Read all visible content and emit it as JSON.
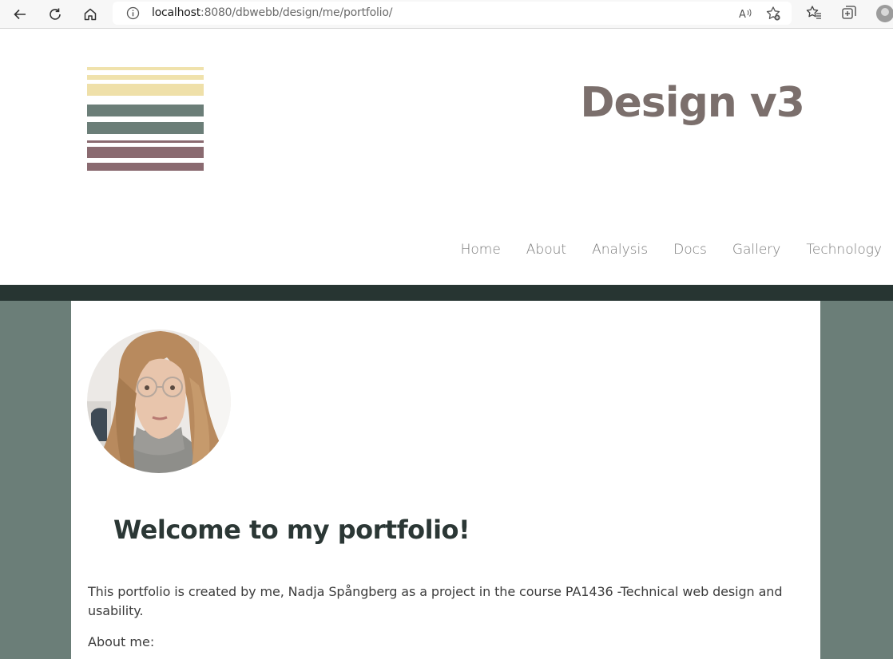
{
  "browser": {
    "url_host": "localhost",
    "url_rest": ":8080/dbwebb/design/me/portfolio/",
    "icons": [
      "back-icon",
      "refresh-icon",
      "home-icon",
      "info-icon",
      "read-aloud-icon",
      "add-favorite-icon",
      "favorites-icon",
      "collections-icon",
      "profile-icon"
    ]
  },
  "site": {
    "title": "Design v3",
    "logo_colors": [
      "#f3e5b0",
      "#6b7e78",
      "#8a6a70"
    ],
    "nav": [
      {
        "label": "Home"
      },
      {
        "label": "About"
      },
      {
        "label": "Analysis"
      },
      {
        "label": "Docs"
      },
      {
        "label": "Gallery"
      },
      {
        "label": "Technology"
      }
    ]
  },
  "main": {
    "heading": "Welcome to my portfolio!",
    "intro": "This portfolio is created by me, Nadja Spångberg as a project in the course PA1436 -Technical web design and usability.",
    "about_label": "About me:"
  },
  "colors": {
    "dark_bar": "#273532",
    "page_bg": "#6b7e78",
    "title": "#7b6f6c",
    "heading": "#2b3735"
  }
}
